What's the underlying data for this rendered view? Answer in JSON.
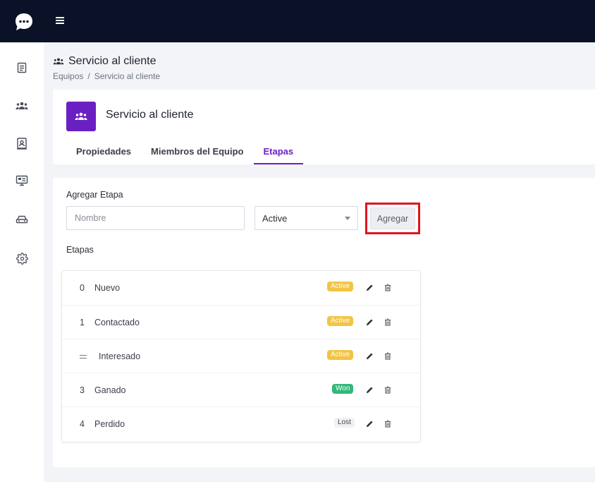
{
  "topbar": {
    "logo_icon": "chat-bubble-icon",
    "menu_icon": "hamburger-icon"
  },
  "sidebar": {
    "items": [
      {
        "icon": "document-icon"
      },
      {
        "icon": "users-icon"
      },
      {
        "icon": "contact-card-icon"
      },
      {
        "icon": "monitor-icon"
      },
      {
        "icon": "car-icon"
      },
      {
        "icon": "gear-icon"
      }
    ]
  },
  "header": {
    "title": "Servicio al cliente",
    "breadcrumb": {
      "parent": "Equipos",
      "separator": "/",
      "current": "Servicio al cliente"
    }
  },
  "team": {
    "name": "Servicio al cliente",
    "avatar_color": "#6a1fc2",
    "tabs": [
      {
        "label": "Propiedades"
      },
      {
        "label": "Miembros del Equipo"
      },
      {
        "label": "Etapas"
      }
    ],
    "active_tab": "Etapas"
  },
  "add_stage": {
    "label": "Agregar Etapa",
    "name_placeholder": "Nombre",
    "status_selected": "Active",
    "add_button": "Agregar"
  },
  "stages": {
    "label": "Etapas",
    "rows": [
      {
        "index": "0",
        "name": "Nuevo",
        "status": "Active"
      },
      {
        "index": "1",
        "name": "Contactado",
        "status": "Active"
      },
      {
        "index": "",
        "name": "Interesado",
        "status": "Active"
      },
      {
        "index": "3",
        "name": "Ganado",
        "status": "Won"
      },
      {
        "index": "4",
        "name": "Perdido",
        "status": "Lost"
      }
    ]
  },
  "colors": {
    "accent": "#6a1fc2",
    "active": "#f2c443",
    "won": "#33b87a",
    "highlight": "#e0141c"
  }
}
